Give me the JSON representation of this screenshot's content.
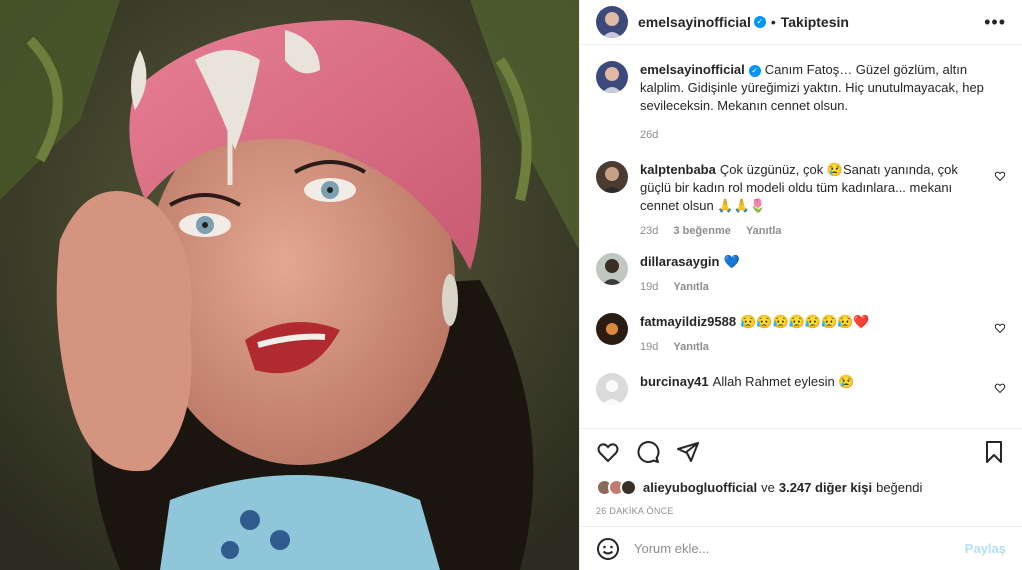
{
  "post": {
    "username": "emelsayinofficial",
    "follow_label": "Takiptesin",
    "more_label": "•••"
  },
  "caption": {
    "username": "emelsayinofficial",
    "text": "Canım Fatoş… Güzel gözlüm, altın kalplim. Gidişinle yüreğimizi yaktın. Hiç unutulmayacak, hep sevileceksin. Mekanın cennet olsun.",
    "time": "26d"
  },
  "comments": [
    {
      "username": "kalptenbaba",
      "text": "Çok üzgünüz, çok 😢Sanatı yanında, çok güçlü bir kadın rol modeli oldu tüm kadınlara... mekanı cennet olsun 🙏🙏🌷",
      "time": "23d",
      "likes": "3 beğenme",
      "reply": "Yanıtla"
    },
    {
      "username": "dillarasaygin",
      "text": "💙",
      "time": "19d",
      "reply": "Yanıtla"
    },
    {
      "username": "fatmayildiz9588",
      "text": "😥😥😥😥😥😥😥❤️",
      "time": "19d",
      "reply": "Yanıtla"
    },
    {
      "username": "burcinay41",
      "text": "Allah Rahmet eylesin 😢"
    }
  ],
  "likes": {
    "username": "alieyubogluofficial",
    "connector": "ve",
    "others": "3.247 diğer kişi",
    "suffix": "beğendi"
  },
  "timestamp": "26 DAKİKA ÖNCE",
  "add_comment": {
    "placeholder": "Yorum ekle...",
    "post_label": "Paylaş"
  },
  "colors": {
    "verified": "#0095f6",
    "post_button": "#b2dffc",
    "muted": "#8e8e8e"
  }
}
